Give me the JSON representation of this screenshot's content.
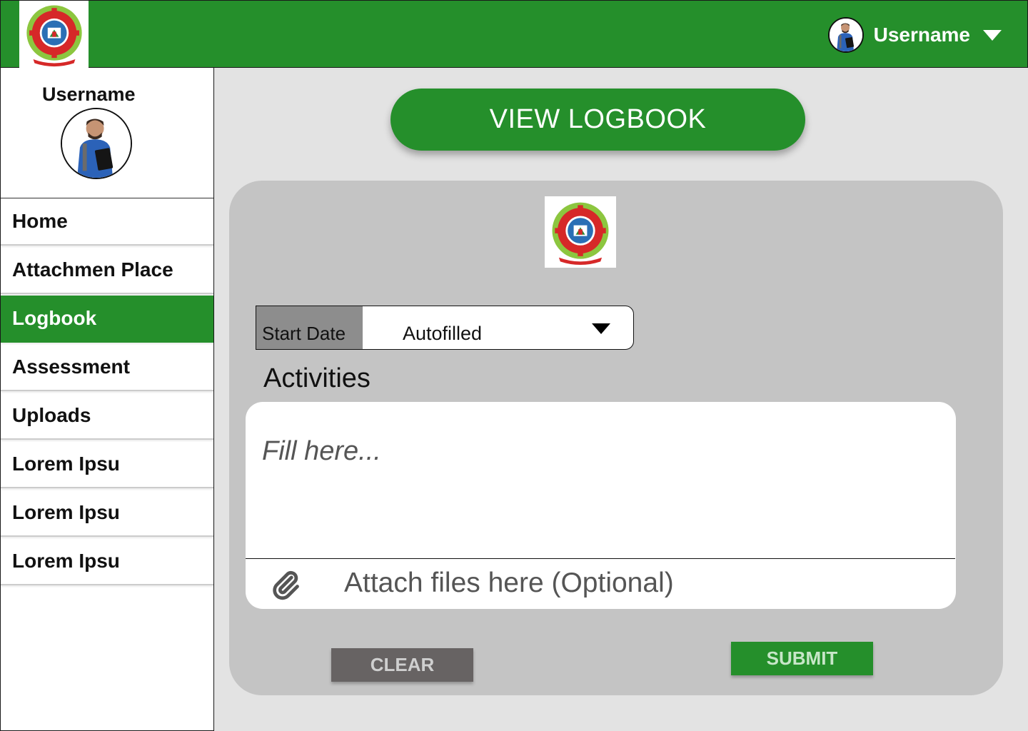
{
  "header": {
    "username": "Username",
    "brand_color": "#258f2b",
    "logo_icon": "university-logo-icon",
    "avatar_icon": "user-avatar-icon",
    "dropdown_icon": "caret-down-icon"
  },
  "sidebar": {
    "profile": {
      "name": "Username",
      "avatar_icon": "user-avatar-icon"
    },
    "items": [
      {
        "label": "Home",
        "active": false
      },
      {
        "label": "Attachmen Place",
        "active": false
      },
      {
        "label": "Logbook",
        "active": true
      },
      {
        "label": "Assessment",
        "active": false
      },
      {
        "label": "Uploads",
        "active": false
      },
      {
        "label": "Lorem Ipsu",
        "active": false
      },
      {
        "label": "Lorem Ipsu",
        "active": false
      },
      {
        "label": "Lorem Ipsu",
        "active": false
      }
    ]
  },
  "main": {
    "view_logbook_label": "VIEW LOGBOOK",
    "form": {
      "start_date_label": "Start Date",
      "start_date_value": "Autofilled",
      "activities_label": "Activities",
      "activities_placeholder": "Fill here...",
      "attach_label": "Attach files here (Optional)",
      "attach_icon": "paperclip-icon",
      "clear_label": "CLEAR",
      "submit_label": "SUBMIT"
    }
  }
}
